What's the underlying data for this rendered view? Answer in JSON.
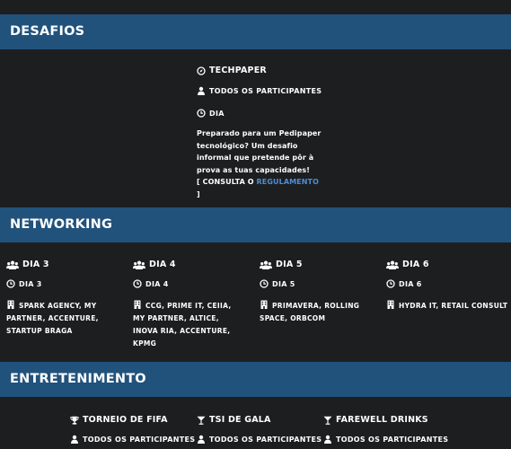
{
  "sections": {
    "desafios": {
      "title": "DESAFIOS",
      "event": {
        "name": "TECHPAPER",
        "audience": "TODOS OS PARTICIPANTES",
        "when": "DIA",
        "description": "Preparado para um Pedipaper tecnológico? Um desafio informal que pretende pôr à prova as tuas capacidades!",
        "rules_prefix": "[ CONSULTA O",
        "rules_link": "REGULAMENTO",
        "rules_suffix": "]"
      }
    },
    "networking": {
      "title": "NETWORKING",
      "columns": [
        {
          "group": "DIA 3",
          "day": "DIA 3",
          "companies": "SPARK AGENCY, MY PARTNER, ACCENTURE, STARTUP BRAGA"
        },
        {
          "group": "DIA 4",
          "day": "DIA 4",
          "companies": "CCG, PRIME IT, CEIIA, MY PARTNER, ALTICE, INOVA RIA, ACCENTURE, KPMG"
        },
        {
          "group": "DIA 5",
          "day": "DIA 5",
          "companies": "PRIMAVERA, ROLLING SPACE, ORBCOM"
        },
        {
          "group": "DIA 6",
          "day": "DIA 6",
          "companies": "HYDRA IT, RETAIL CONSULT"
        }
      ]
    },
    "entretenimento": {
      "title": "ENTRETENIMENTO",
      "events": [
        {
          "name": "TORNEIO DE FIFA",
          "audience": "TODOS OS PARTICIPANTES",
          "icon": "trophy-icon"
        },
        {
          "name": "TSI DE GALA",
          "audience": "TODOS OS PARTICIPANTES",
          "icon": "cocktail-icon"
        },
        {
          "name": "FAREWELL DRINKS",
          "audience": "TODOS OS PARTICIPANTES",
          "icon": "cocktail-icon"
        }
      ]
    }
  },
  "colors": {
    "background": "#1d1e20",
    "band": "#21527c",
    "link": "#4c8fd6",
    "text": "#ffffff"
  }
}
